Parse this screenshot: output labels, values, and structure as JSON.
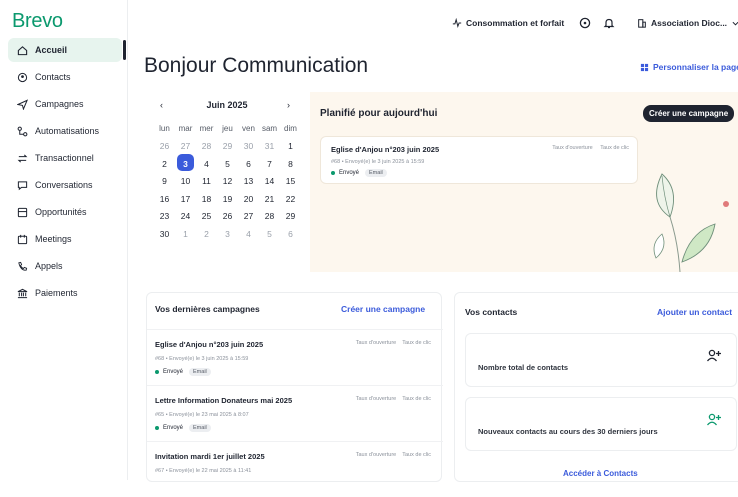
{
  "app": {
    "logo": "Brevo"
  },
  "sidebar": {
    "items": [
      {
        "label": "Accueil",
        "icon": "home-icon"
      },
      {
        "label": "Contacts",
        "icon": "contacts-icon"
      },
      {
        "label": "Campagnes",
        "icon": "send-icon"
      },
      {
        "label": "Automatisations",
        "icon": "automation-icon"
      },
      {
        "label": "Transactionnel",
        "icon": "transactional-icon"
      },
      {
        "label": "Conversations",
        "icon": "chat-icon"
      },
      {
        "label": "Opportunités",
        "icon": "deals-icon"
      },
      {
        "label": "Meetings",
        "icon": "calendar-icon"
      },
      {
        "label": "Appels",
        "icon": "phone-icon"
      },
      {
        "label": "Paiements",
        "icon": "bank-icon"
      }
    ]
  },
  "topbar": {
    "usage": "Consommation et forfait",
    "account": "Association Dioc..."
  },
  "main": {
    "title": "Bonjour Communication",
    "personalize": "Personnaliser la page"
  },
  "calendar": {
    "month": "Juin 2025",
    "prev": "‹",
    "next": "›",
    "weekdays": [
      "lun",
      "mar",
      "mer",
      "jeu",
      "ven",
      "sam",
      "dim"
    ],
    "weeks": [
      [
        "26",
        "27",
        "28",
        "29",
        "30",
        "31",
        "1"
      ],
      [
        "2",
        "3",
        "4",
        "5",
        "6",
        "7",
        "8"
      ],
      [
        "9",
        "10",
        "11",
        "12",
        "13",
        "14",
        "15"
      ],
      [
        "16",
        "17",
        "18",
        "19",
        "20",
        "21",
        "22"
      ],
      [
        "23",
        "24",
        "25",
        "26",
        "27",
        "28",
        "29"
      ],
      [
        "30",
        "1",
        "2",
        "3",
        "4",
        "5",
        "6"
      ]
    ],
    "today": "3"
  },
  "planned": {
    "title": "Planifié pour aujourd'hui",
    "create": "Créer une campagne",
    "campaign": {
      "name": "Eglise d'Anjou n°203 juin 2025",
      "meta": "#68 • Envoyé(e) le 3 juin 2025 à 15:59",
      "status": "Envoyé",
      "type": "Email",
      "open_rate": "Taux d'ouverture",
      "click_rate": "Taux de clic"
    }
  },
  "recent": {
    "title": "Vos dernières campagnes",
    "create": "Créer une campagne",
    "items": [
      {
        "name": "Eglise d'Anjou n°203 juin 2025",
        "meta": "#68 • Envoyé(e) le 3 juin 2025 à 15:59",
        "status": "Envoyé",
        "type": "Email",
        "open_rate": "Taux d'ouverture",
        "click_rate": "Taux de clic"
      },
      {
        "name": "Lettre Information Donateurs mai 2025",
        "meta": "#65 • Envoyé(e) le 23 mai 2025 à 8:07",
        "status": "Envoyé",
        "type": "Email",
        "open_rate": "Taux d'ouverture",
        "click_rate": "Taux de clic"
      },
      {
        "name": "Invitation mardi 1er juillet 2025",
        "meta": "#67 • Envoyé(e) le 22 mai 2025 à 11:41",
        "status": "",
        "type": "",
        "open_rate": "Taux d'ouverture",
        "click_rate": "Taux de clic"
      }
    ]
  },
  "contacts": {
    "title": "Vos contacts",
    "add": "Ajouter un contact",
    "total_label": "Nombre total de contacts",
    "new_label": "Nouveaux contacts au cours des 30 derniers jours",
    "access": "Accéder à Contacts"
  },
  "colors": {
    "brand": "#0b996e",
    "accent": "#3b5bdb",
    "dark": "#1f2430"
  }
}
